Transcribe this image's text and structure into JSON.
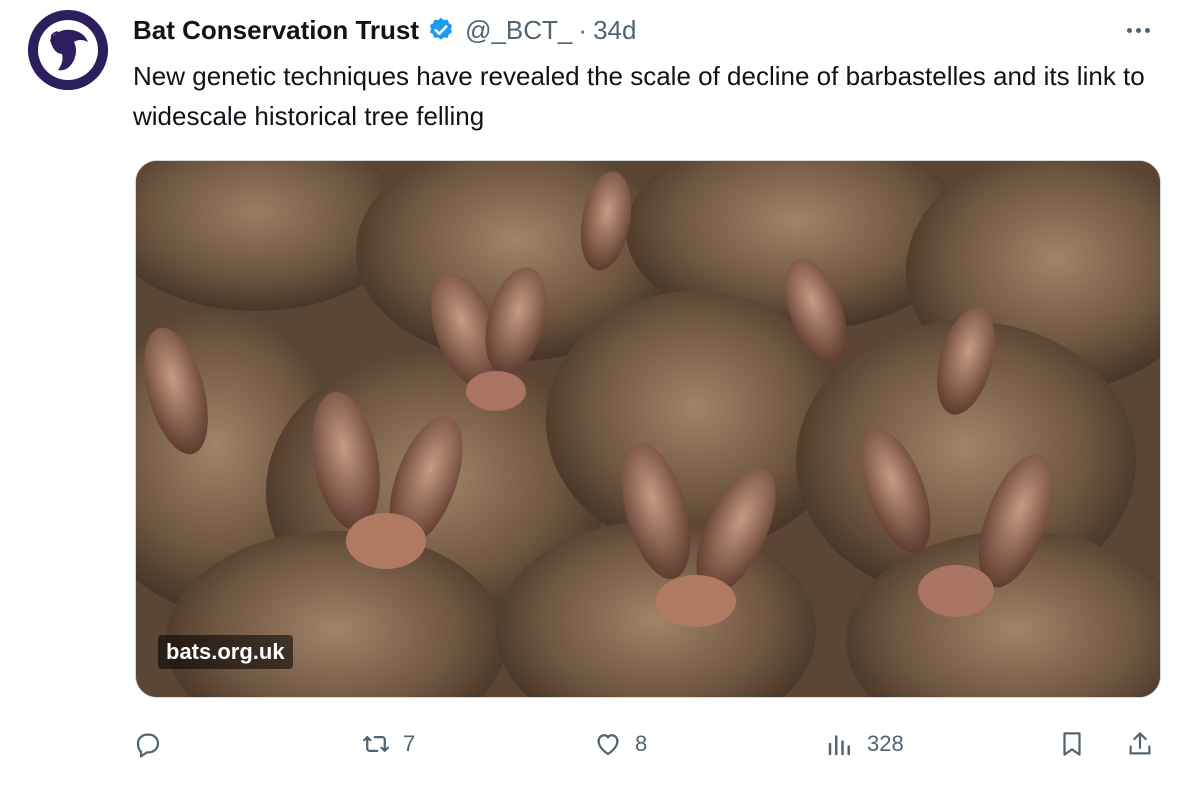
{
  "account": {
    "name": "Bat Conservation Trust",
    "handle": "@_BCT_",
    "separator": "·",
    "time": "34d"
  },
  "tweet": {
    "text": "New genetic techniques have revealed the scale of decline of barbastelles and its link to widescale historical tree felling"
  },
  "media": {
    "credit": "bats.org.uk"
  },
  "actions": {
    "retweets": "7",
    "likes": "8",
    "views": "328"
  },
  "icons": {
    "verified": "verified-badge-icon",
    "more": "more-icon",
    "reply": "reply-icon",
    "retweet": "retweet-icon",
    "like": "like-icon",
    "views": "views-icon",
    "bookmark": "bookmark-icon",
    "share": "share-icon"
  },
  "colors": {
    "verified": "#1d9bf0",
    "secondary_text": "#536471",
    "primary_text": "#0f1419",
    "avatar_bg": "#2d1f5e"
  }
}
